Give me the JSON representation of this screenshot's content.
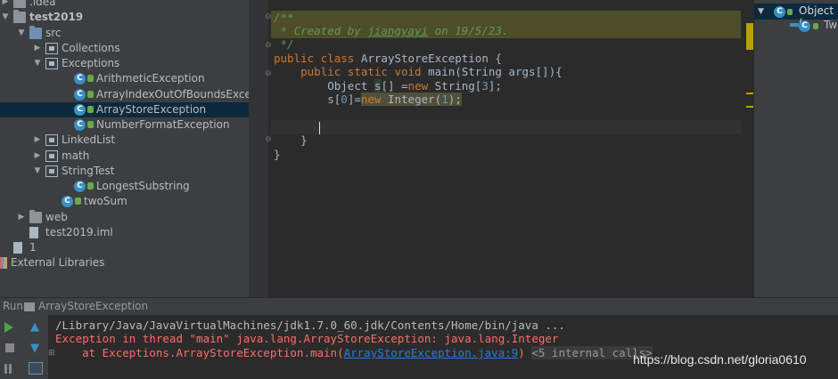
{
  "project_tree": [
    {
      "label": ".idea",
      "kind": "folder",
      "indent": 0,
      "expanded": false
    },
    {
      "label": "test2019",
      "kind": "module",
      "indent": 0,
      "expanded": true,
      "bold": true
    },
    {
      "label": "src",
      "kind": "src",
      "indent": 1,
      "expanded": true
    },
    {
      "label": "Collections",
      "kind": "package",
      "indent": 2,
      "expanded": false
    },
    {
      "label": "Exceptions",
      "kind": "package",
      "indent": 2,
      "expanded": true
    },
    {
      "label": "ArithmeticException",
      "kind": "class",
      "indent": 4
    },
    {
      "label": "ArrayIndexOutOfBoundsException",
      "kind": "class",
      "indent": 4
    },
    {
      "label": "ArrayStoreException",
      "kind": "class",
      "indent": 4,
      "selected": true
    },
    {
      "label": "NumberFormatException",
      "kind": "class",
      "indent": 4
    },
    {
      "label": "LinkedList",
      "kind": "package",
      "indent": 2,
      "expanded": false
    },
    {
      "label": "math",
      "kind": "package",
      "indent": 2,
      "expanded": false
    },
    {
      "label": "StringTest",
      "kind": "package",
      "indent": 2,
      "expanded": true
    },
    {
      "label": "LongestSubstring",
      "kind": "class",
      "indent": 4
    },
    {
      "label": "twoSum",
      "kind": "class",
      "indent": 3
    },
    {
      "label": "web",
      "kind": "folder",
      "indent": 1,
      "expanded": false
    },
    {
      "label": "test2019.iml",
      "kind": "file",
      "indent": 1
    },
    {
      "label": "1",
      "kind": "file",
      "indent": 0
    },
    {
      "label": "External Libraries",
      "kind": "libs",
      "indent": 0
    }
  ],
  "editor": {
    "doc_line1": "/**",
    "doc_line2_prefix": " * Created by ",
    "doc_author": "jiangyayi",
    "doc_line2_suffix": " on 19/5/23.",
    "doc_line3": " */",
    "kw_public": "public",
    "kw_class": "class",
    "class_name": "ArrayStoreException {",
    "kw_static": "static",
    "kw_void": "void",
    "method_sig": "main(String args[]){",
    "line_obj_type": "Object ",
    "line_obj_var": "s",
    "line_obj_mid": "[] =",
    "kw_new": "new",
    "line_obj_rest": " String[",
    "num_3": "3",
    "line_obj_end": "];",
    "line_s": "s[",
    "num_0": "0",
    "line_s_mid": "]=",
    "line_s_int": " Integer(",
    "num_1": "1",
    "line_s_end": ");",
    "close1": "}",
    "close2": "}"
  },
  "structure": {
    "root": "Object (",
    "child": "Two"
  },
  "run": {
    "tab_label": "Run",
    "config_name": "ArrayStoreException",
    "cmd": "/Library/Java/JavaVirtualMachines/jdk1.7.0_60.jdk/Contents/Home/bin/java ...",
    "err1": "Exception in thread \"main\" java.lang.ArrayStoreException: java.lang.Integer",
    "err2_prefix": "    at Exceptions.ArrayStoreException.main(",
    "err2_link": "ArrayStoreException.java:9",
    "err2_suffix": ")",
    "internal": "<5 internal calls>"
  },
  "watermark": "https://blog.csdn.net/gloria0610",
  "colors": {
    "keyword": "#cc7832",
    "comment": "#629755",
    "number": "#6897bb",
    "error": "#ff6b68",
    "link": "#287bde"
  }
}
